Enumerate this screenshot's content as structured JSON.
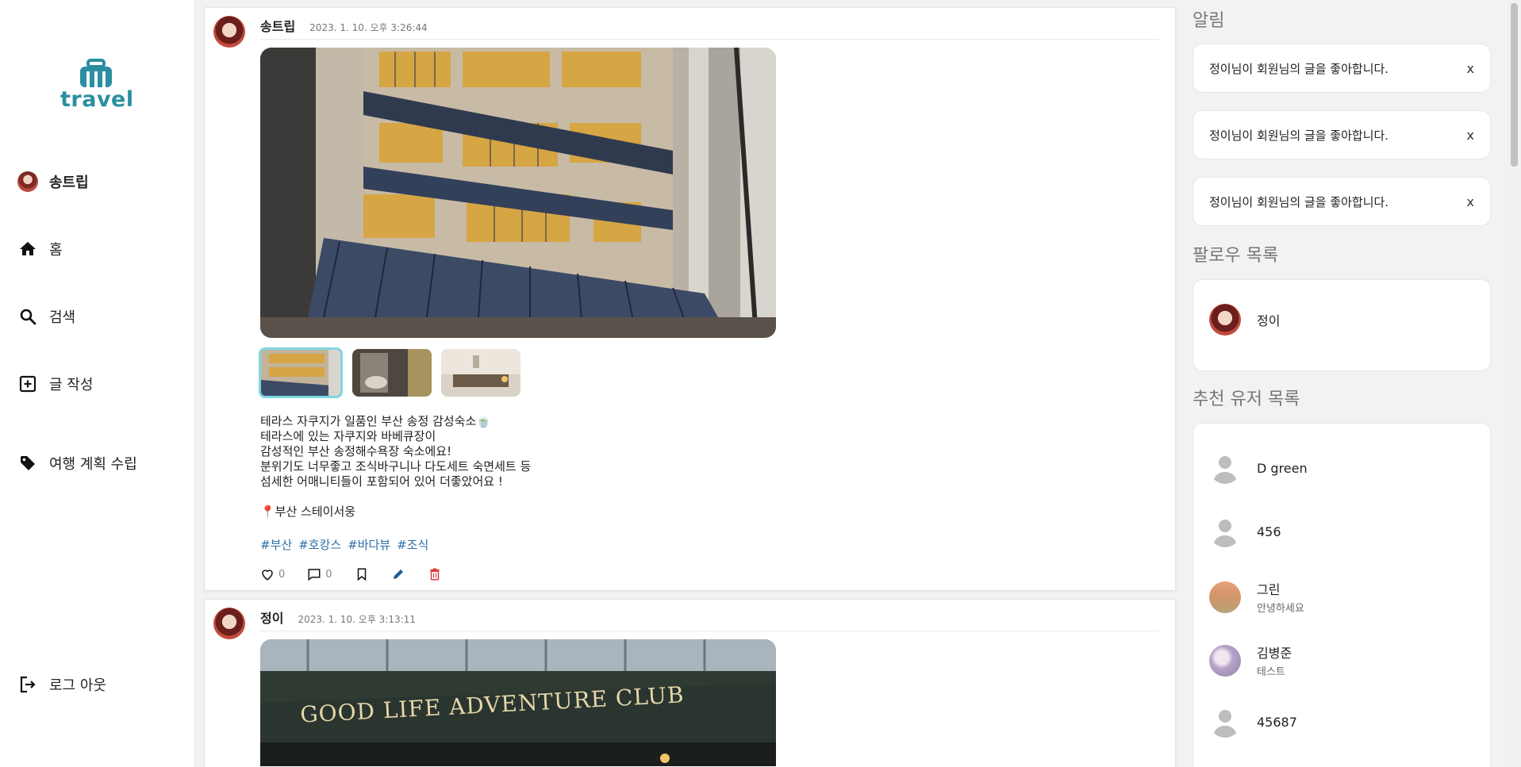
{
  "sidebar": {
    "logo_text": "travel",
    "profile_name": "송트립",
    "items": [
      {
        "label": "홈",
        "icon": "home-icon"
      },
      {
        "label": "검색",
        "icon": "search-icon"
      },
      {
        "label": "글 작성",
        "icon": "add-box-icon"
      },
      {
        "label": "여행 계획 수립",
        "icon": "tag-icon"
      }
    ],
    "logout_label": "로그 아웃"
  },
  "posts": [
    {
      "author": "송트립",
      "time": "2023. 1. 10. 오후 3:26:44",
      "caption_lines": [
        "테라스 자쿠지가 일품인 부산 송정 감성숙소🍵",
        "테라스에 있는 자쿠지와 바베큐장이",
        "감성적인 부산 송정해수욕장 숙소에요!",
        "분위기도 너무좋고 조식바구니나 다도세트 숙면세트 등",
        "섬세한 어매니티들이 포함되어 있어 더좋았어요 !",
        "",
        "📍부산 스테이서웅"
      ],
      "tags": [
        "#부산",
        "#호캉스",
        "#바다뷰",
        "#조식"
      ],
      "like_count": "0",
      "comment_count": "0"
    },
    {
      "author": "정이",
      "time": "2023. 1. 10. 오후 3:13:11",
      "sign_text": "GOOD LIFE ADVENTURE CLUB"
    }
  ],
  "right": {
    "notifications_title": "알림",
    "notifications": [
      {
        "text": "정이님이 회원님의 글을 좋아합니다.",
        "close": "x"
      },
      {
        "text": "정이님이 회원님의 글을 좋아합니다.",
        "close": "x"
      },
      {
        "text": "정이님이 회원님의 글을 좋아합니다.",
        "close": "x"
      }
    ],
    "follow_title": "팔로우 목록",
    "follows": [
      {
        "name": "정이"
      }
    ],
    "recommend_title": "추천 유저 목록",
    "recommends": [
      {
        "name": "D green",
        "sub": ""
      },
      {
        "name": "456",
        "sub": ""
      },
      {
        "name": "그린",
        "sub": "안녕하세요"
      },
      {
        "name": "김병준",
        "sub": "테스트"
      },
      {
        "name": "45687",
        "sub": ""
      }
    ]
  }
}
